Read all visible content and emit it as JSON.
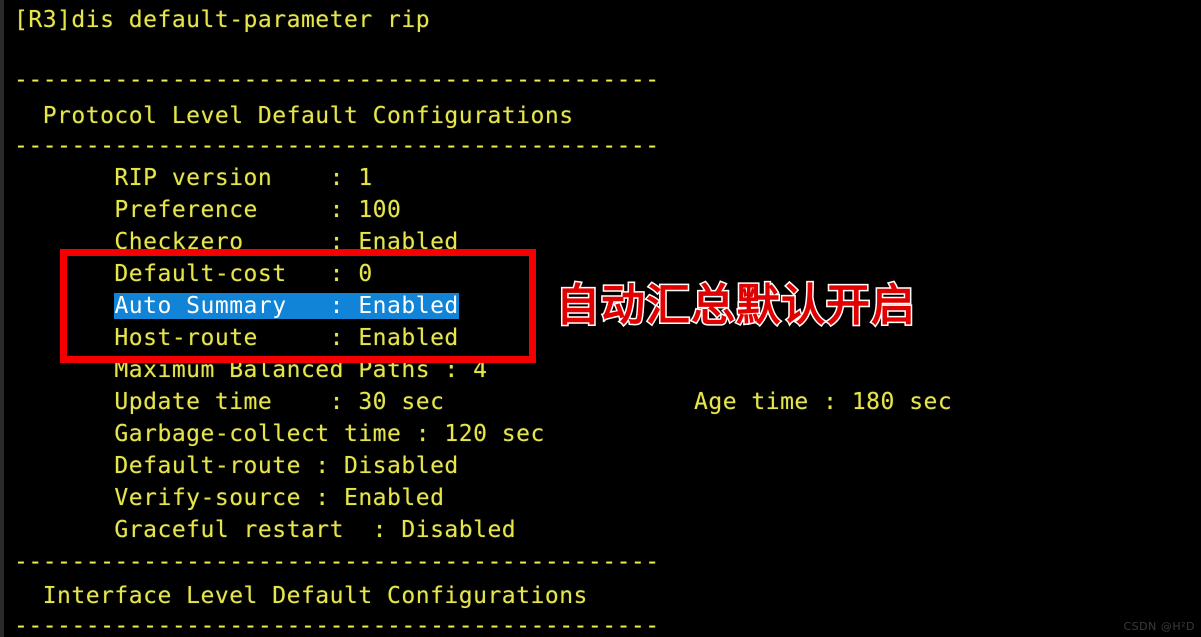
{
  "terminal": {
    "background_color": "#000000",
    "text_color": "#e6e64c",
    "selection_bg_color": "#1284d8",
    "selection_text_color": "#ffffff",
    "prompt_line": "[R3]dis default-parameter rip",
    "separator": "---------------------------------------------",
    "protocol_section_title": "Protocol Level Default Configurations",
    "interface_section_title": "Interface Level Default Configurations",
    "rows": [
      {
        "label": "RIP version",
        "separator": ":",
        "value": "1"
      },
      {
        "label": "Preference",
        "separator": ":",
        "value": "100"
      },
      {
        "label": "Checkzero",
        "separator": ":",
        "value": "Enabled"
      },
      {
        "label": "Default-cost",
        "separator": ":",
        "value": "0"
      },
      {
        "label": "Auto Summary",
        "separator": ":",
        "value": "Enabled"
      },
      {
        "label": "Host-route",
        "separator": ":",
        "value": "Enabled"
      },
      {
        "label": "Maximum Balanced Paths",
        "separator": ":",
        "value": "4"
      },
      {
        "label": "Update time",
        "separator": ":",
        "value": "30 sec"
      },
      {
        "label": "Garbage-collect time",
        "separator": ":",
        "value": "120 sec"
      },
      {
        "label": "Default-route",
        "separator": ":",
        "value": "Disabled"
      },
      {
        "label": "Verify-source",
        "separator": ":",
        "value": "Enabled"
      },
      {
        "label": "Graceful restart",
        "separator": ":",
        "value": "Disabled"
      }
    ],
    "lines": {
      "l1_prompt": "[R3]dis default-parameter rip",
      "l2_rule_top": "---------------------------------------------",
      "l3_protocol_title": "  Protocol Level Default Configurations",
      "l4_rule": "---------------------------------------------",
      "l5_rip_version": "       RIP version    : 1",
      "l6_preference": "       Preference     : 100",
      "l7_checkzero": "       Checkzero      : Enabled",
      "l8_default_cost": "       Default-cost   : 0",
      "l9_auto_summary_indent": "       ",
      "l9_auto_summary_sel": "Auto Summary   : Enabled",
      "l10_host_route": "       Host-route     : Enabled",
      "l11_max_balanced": "       Maximum Balanced Paths : 4",
      "l12_update_time": "       Update time    : 30 sec",
      "l12_age_time": "Age time : 180 sec",
      "l13_garbage": "       Garbage-collect time : 120 sec",
      "l14_default_route": "       Default-route : Disabled",
      "l15_verify_source": "       Verify-source : Enabled",
      "l16_graceful": "       Graceful restart  : Disabled",
      "l17_rule": "---------------------------------------------",
      "l18_interface_title": "  Interface Level Default Configurations",
      "l19_rule": "---------------------------------------------"
    }
  },
  "annotations": {
    "red_box": {
      "color": "#f40000",
      "border_width_px": 7,
      "encloses": "Default-cost / Auto Summary / Host-route"
    },
    "caption": {
      "text": "自动汇总默认开启",
      "fill_color": "#e00000",
      "outline_color": "#ffffff"
    },
    "highlight": {
      "row_label": "Auto Summary",
      "row_value": "Enabled",
      "bg_color": "#1284d8",
      "text_color": "#ffffff"
    }
  },
  "watermark": {
    "text": "CSDN @H²D",
    "color": "#3b3b3b"
  }
}
